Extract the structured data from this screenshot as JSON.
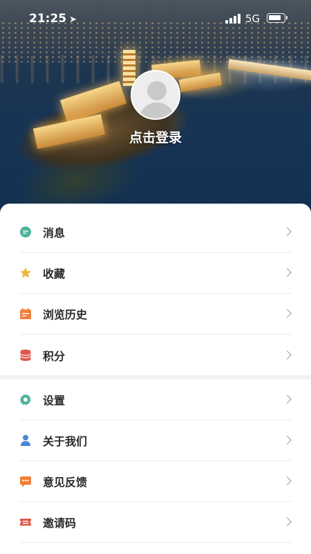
{
  "status_bar": {
    "time": "21:25",
    "location_icon": "location-arrow-icon",
    "network": "5G",
    "battery_level": 0.85
  },
  "profile": {
    "avatar_icon": "default-avatar-icon",
    "login_label": "点击登录"
  },
  "menu_group_1": {
    "items": [
      {
        "label": "消息",
        "icon": "message-bubble-icon",
        "color": "#4fb39a"
      },
      {
        "label": "收藏",
        "icon": "star-icon",
        "color": "#f0b43c"
      },
      {
        "label": "浏览历史",
        "icon": "calendar-icon",
        "color": "#ef7f3a"
      },
      {
        "label": "积分",
        "icon": "coins-stack-icon",
        "color": "#e0584a"
      }
    ]
  },
  "menu_group_2": {
    "items": [
      {
        "label": "设置",
        "icon": "gear-icon",
        "color": "#4fb39a"
      },
      {
        "label": "关于我们",
        "icon": "person-icon",
        "color": "#4a86d8"
      },
      {
        "label": "意见反馈",
        "icon": "feedback-bubble-icon",
        "color": "#ef7f3a"
      },
      {
        "label": "邀请码",
        "icon": "ticket-icon",
        "color": "#e0584a"
      }
    ]
  }
}
